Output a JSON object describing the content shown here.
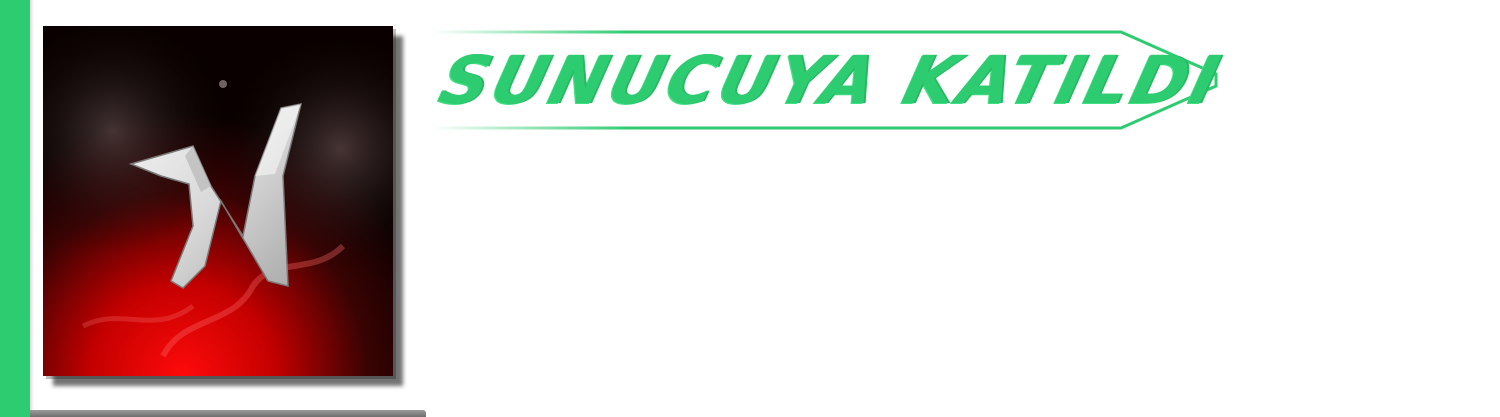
{
  "banner": {
    "title": "SUNUCUYA KATILDI"
  },
  "avatar": {
    "icon": "stylized-letter-n-logo"
  },
  "colors": {
    "accent": "#2ecc71",
    "avatar_glow": "#ff0000"
  }
}
